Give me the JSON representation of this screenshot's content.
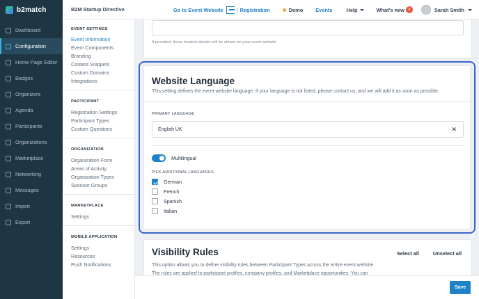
{
  "brand": {
    "name": "b2match"
  },
  "header": {
    "event_name": "B2M Startup Directive",
    "event_website": "Go to Event Website",
    "registration": "Registration",
    "separator": "|",
    "demo": "Demo",
    "events": "Events",
    "help": "Help",
    "whats_new": "What's new",
    "whats_new_count": "3",
    "user_name": "Sarah Smith"
  },
  "sidebar": {
    "items": [
      {
        "label": "Dashboard"
      },
      {
        "label": "Configuration"
      },
      {
        "label": "Home Page Editor"
      },
      {
        "label": "Badges"
      },
      {
        "label": "Organizers"
      },
      {
        "label": "Agenda"
      },
      {
        "label": "Participants"
      },
      {
        "label": "Organizations"
      },
      {
        "label": "Marketplace"
      },
      {
        "label": "Networking"
      },
      {
        "label": "Messages"
      },
      {
        "label": "Import"
      },
      {
        "label": "Export"
      }
    ]
  },
  "subnav": {
    "sections": [
      {
        "title": "EVENT SETTINGS",
        "items": [
          "Event Information",
          "Event Components",
          "Branding",
          "Content Snippets",
          "Custom Domains",
          "Integrations"
        ]
      },
      {
        "title": "PARTICIPANT",
        "items": [
          "Registration Settings",
          "Participant Types",
          "Custom Questions"
        ]
      },
      {
        "title": "ORGANIZATION",
        "items": [
          "Organization Form",
          "Areas of Activity",
          "Organization Types",
          "Sponsor Groups"
        ]
      },
      {
        "title": "MARKETPLACE",
        "items": [
          "Settings"
        ]
      },
      {
        "title": "MOBILE APPLICATION",
        "items": [
          "Settings",
          "Resources",
          "Push Notifications"
        ]
      }
    ]
  },
  "location": {
    "hint": "If provided, these location details will be shown on your event website."
  },
  "language": {
    "title": "Website Language",
    "description": "This setting defines the event website language. If your language is not listed, please contact us, and we will add it as soon as possible.",
    "primary_label": "PRIMARY LANGUAGE",
    "primary_value": "English UK",
    "multilingual_label": "Multilingual",
    "additional_label": "PICK ADDITIONAL LANGUAGES",
    "options": [
      {
        "label": "German",
        "checked": true
      },
      {
        "label": "French",
        "checked": false
      },
      {
        "label": "Spanish",
        "checked": false
      },
      {
        "label": "Italian",
        "checked": false
      }
    ]
  },
  "visibility": {
    "title": "Visibility Rules",
    "select_all": "Select all",
    "unselect_all": "Unselect all",
    "description_1": "This option allows you to define visibility rules between Participant Types across the entire event website.",
    "description_2": "The rules are applied to participant profiles, company profiles, and Marketplace opportunities. You can"
  },
  "footer": {
    "save_label": "Save"
  },
  "colors": {
    "accent": "#1e82c8",
    "sidebar": "#1e3644",
    "highlight_frame": "#3b63c9"
  }
}
